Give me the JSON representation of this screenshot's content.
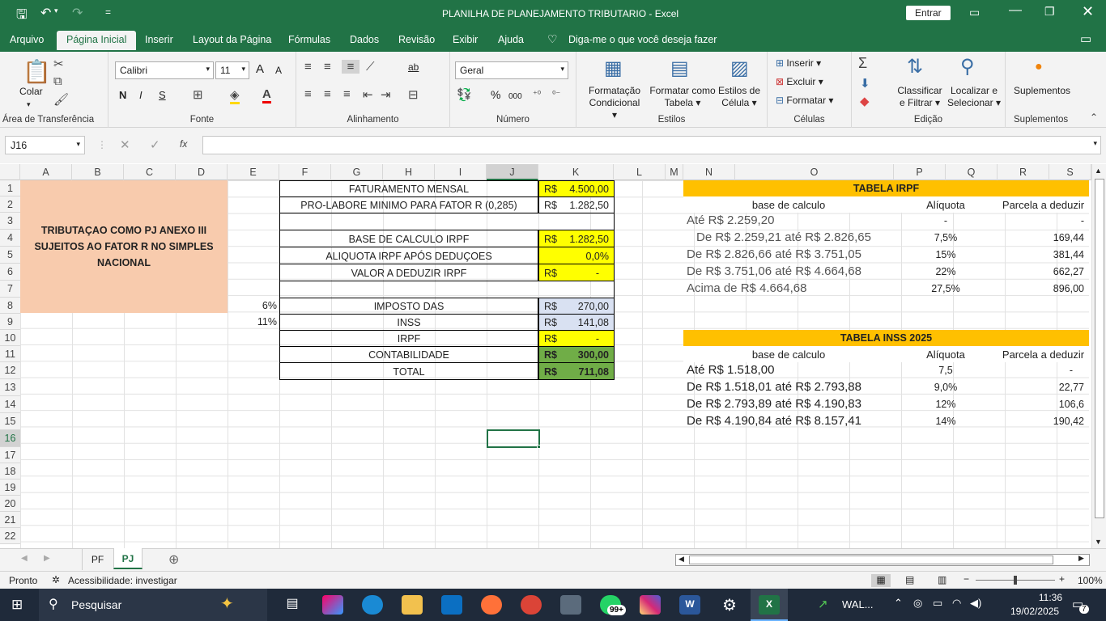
{
  "titlebar": {
    "title": "PLANILHA DE PLANEJAMENTO TRIBUTARIO  -  Excel",
    "signin": "Entrar",
    "qat_more": "="
  },
  "menu": {
    "items": [
      "Arquivo",
      "Página Inicial",
      "Inserir",
      "Layout da Página",
      "Fórmulas",
      "Dados",
      "Revisão",
      "Exibir",
      "Ajuda"
    ],
    "tellme": "Diga-me o que você deseja fazer"
  },
  "ribbon": {
    "clipboard": {
      "label": "Área de Transferência",
      "paste": "Colar"
    },
    "font": {
      "label": "Fonte",
      "family": "Calibri",
      "size": "11",
      "bold": "N",
      "italic": "I",
      "underline": "S",
      "grow": "A",
      "shrink": "A"
    },
    "alignment": {
      "label": "Alinhamento",
      "wrap": "ab"
    },
    "number": {
      "label": "Número",
      "format": "Geral",
      "percent": "%",
      "thousands": "000"
    },
    "styles": {
      "label": "Estilos",
      "cond": "Formatação",
      "cond2": "Condicional",
      "table": "Formatar como",
      "table2": "Tabela",
      "cell": "Estilos de",
      "cell2": "Célula"
    },
    "cells": {
      "label": "Células",
      "insert": "Inserir",
      "delete": "Excluir",
      "format": "Formatar"
    },
    "editing": {
      "label": "Edição",
      "sort": "Classificar",
      "sort2": "e Filtrar",
      "find": "Localizar e",
      "find2": "Selecionar"
    },
    "addins": {
      "label": "Suplementos",
      "btn": "Suplementos"
    }
  },
  "formula": {
    "namebox": "J16",
    "fx": "fx",
    "value": ""
  },
  "columns": [
    "A",
    "B",
    "C",
    "D",
    "E",
    "F",
    "G",
    "H",
    "I",
    "J",
    "K",
    "L",
    "M",
    "N",
    "O",
    "P",
    "Q",
    "R",
    "S"
  ],
  "rows": [
    "1",
    "2",
    "3",
    "4",
    "5",
    "6",
    "7",
    "8",
    "9",
    "10",
    "11",
    "12",
    "13",
    "14",
    "15",
    "16",
    "17",
    "18",
    "19",
    "20",
    "21",
    "22"
  ],
  "sheet": {
    "pj_title": "TRIBUTAÇAO COMO PJ ANEXO III SUJEITOS AO FATOR R NO SIMPLES NACIONAL",
    "rows": {
      "faturamento": {
        "label": "FATURAMENTO MENSAL",
        "cur": "R$",
        "val": "4.500,00"
      },
      "prolabore": {
        "label": "PRO-LABORE MINIMO PARA FATOR R (0,285)",
        "cur": "R$",
        "val": "1.282,50"
      },
      "base": {
        "label": "BASE DE CALCULO IRPF",
        "cur": "R$",
        "val": "1.282,50"
      },
      "aliquota": {
        "label": "ALIQUOTA IRPF APÓS DEDUÇOES",
        "val": "0,0%"
      },
      "deduzir": {
        "label": "VALOR A DEDUZIR IRPF",
        "cur": "R$",
        "val": "-"
      },
      "das": {
        "pct": "6%",
        "label": "IMPOSTO DAS",
        "cur": "R$",
        "val": "270,00"
      },
      "inss": {
        "pct": "11%",
        "label": "INSS",
        "cur": "R$",
        "val": "141,08"
      },
      "irpf": {
        "label": "IRPF",
        "cur": "R$",
        "val": "-"
      },
      "contab": {
        "label": "CONTABILIDADE",
        "cur": "R$",
        "val": "300,00"
      },
      "total": {
        "label": "TOTAL",
        "cur": "R$",
        "val": "711,08"
      }
    },
    "irpf_table": {
      "title": "TABELA IRPF",
      "h1": "base de calculo",
      "h2": "Alíquota",
      "h3": "Parcela a deduzir",
      "rows": [
        [
          "Até R$ 2.259,20",
          "-",
          "-"
        ],
        [
          "De R$ 2.259,21 até R$ 2.826,65",
          "7,5%",
          "169,44"
        ],
        [
          "De R$ 2.826,66 até R$ 3.751,05",
          "15%",
          "381,44"
        ],
        [
          "De R$ 3.751,06 até R$ 4.664,68",
          "22%",
          "662,27"
        ],
        [
          "Acima de R$ 4.664,68",
          "27,5%",
          "896,00"
        ]
      ]
    },
    "inss_table": {
      "title": "TABELA INSS 2025",
      "h1": "base de calculo",
      "h2": "Alíquota",
      "h3": "Parcela a deduzir",
      "rows": [
        [
          "Até R$ 1.518,00",
          "7,5",
          "-"
        ],
        [
          "De R$ 1.518,01 até R$ 2.793,88",
          "9,0%",
          "22,77"
        ],
        [
          "De R$ 2.793,89 até R$ 4.190,83",
          "12%",
          "106,6"
        ],
        [
          "De R$ 4.190,84 até R$ 8.157,41",
          "14%",
          "190,42"
        ]
      ]
    }
  },
  "tabs": {
    "pf": "PF",
    "pj": "PJ"
  },
  "status": {
    "ready": "Pronto",
    "access": "Acessibilidade: investigar",
    "zoom": "100%"
  },
  "taskbar": {
    "search": "Pesquisar",
    "badge": "99+",
    "app": "WAL...",
    "time": "11:36",
    "date": "19/02/2025",
    "notif": "7"
  }
}
